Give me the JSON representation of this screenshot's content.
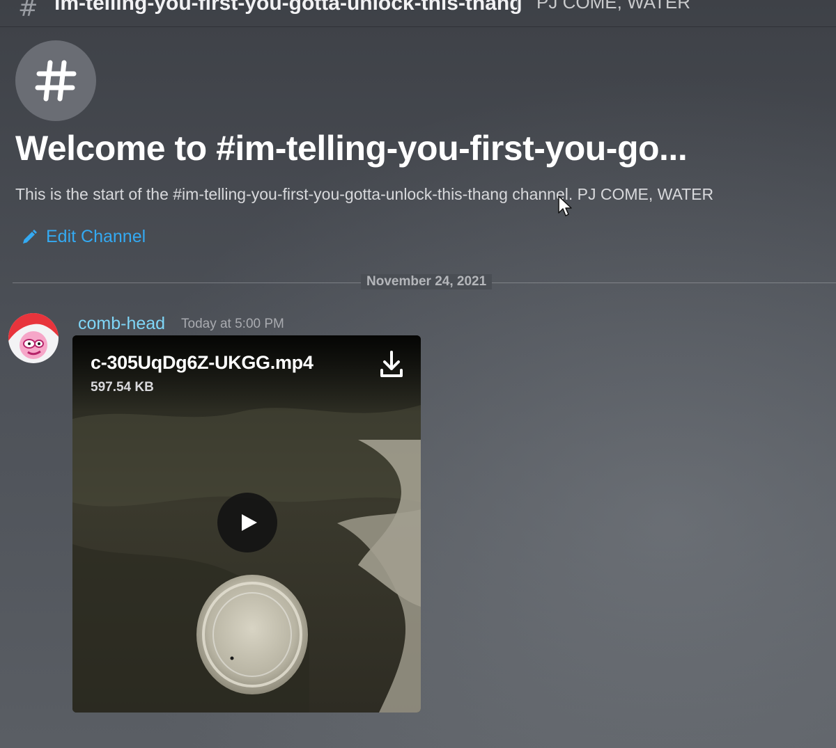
{
  "header": {
    "channel_name": "im-telling-you-first-you-gotta-unlock-this-thang",
    "topic": "PJ COME, WATER"
  },
  "welcome": {
    "title": "Welcome to #im-telling-you-first-you-go...",
    "description": "This is the start of the #im-telling-you-first-you-gotta-unlock-this-thang channel. PJ COME, WATER",
    "edit_label": "Edit Channel"
  },
  "divider": {
    "date": "November 24, 2021"
  },
  "message": {
    "author": "comb-head",
    "timestamp": "Today at 5:00 PM",
    "attachment": {
      "file_name": "c-305UqDg6Z-UKGG.mp4",
      "file_size": "597.54 KB"
    }
  },
  "icons": {
    "channel": "hash-icon",
    "edit": "pencil-icon",
    "download": "download-icon",
    "play": "play-icon"
  },
  "colors": {
    "link": "#34aaf2",
    "author": "#7fd6f7",
    "background": "#4a4e55"
  }
}
